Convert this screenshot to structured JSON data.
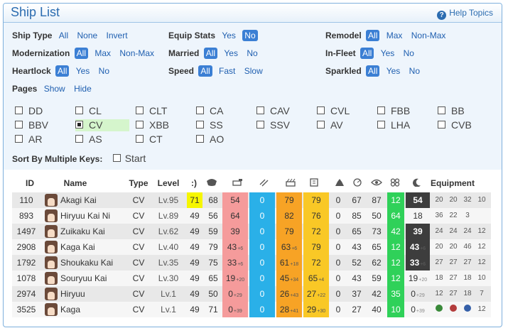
{
  "header": {
    "title": "Ship List",
    "help_label": "Help Topics",
    "help_icon": "question-circle-icon"
  },
  "filters": {
    "ship_type": {
      "label": "Ship Type",
      "options": [
        "All",
        "None",
        "Invert"
      ]
    },
    "equip_stats": {
      "label": "Equip Stats",
      "options": [
        "Yes",
        "No"
      ],
      "selected": "No"
    },
    "remodel": {
      "label": "Remodel",
      "options": [
        "All",
        "Max",
        "Non-Max"
      ],
      "selected": "All"
    },
    "modernization": {
      "label": "Modernization",
      "options": [
        "All",
        "Max",
        "Non-Max"
      ],
      "selected": "All"
    },
    "married": {
      "label": "Married",
      "options": [
        "All",
        "Yes",
        "No"
      ],
      "selected": "All"
    },
    "in_fleet": {
      "label": "In-Fleet",
      "options": [
        "All",
        "Yes",
        "No"
      ],
      "selected": "All"
    },
    "heartlock": {
      "label": "Heartlock",
      "options": [
        "All",
        "Yes",
        "No"
      ],
      "selected": "All"
    },
    "speed": {
      "label": "Speed",
      "options": [
        "All",
        "Fast",
        "Slow"
      ],
      "selected": "All"
    },
    "sparkled": {
      "label": "Sparkled",
      "options": [
        "All",
        "Yes",
        "No"
      ],
      "selected": "All"
    },
    "pages": {
      "label": "Pages",
      "options": [
        "Show",
        "Hide"
      ]
    }
  },
  "ship_types": [
    "DD",
    "CL",
    "CLT",
    "CA",
    "CAV",
    "CVL",
    "FBB",
    "BB",
    "BBV",
    "CV",
    "XBB",
    "SS",
    "SSV",
    "AV",
    "LHA",
    "CVB",
    "AR",
    "AS",
    "CT",
    "AO"
  ],
  "ship_types_checked": [
    "CV"
  ],
  "sort": {
    "label": "Sort By Multiple Keys:",
    "start_label": "Start"
  },
  "columns": {
    "id": "ID",
    "name": "Name",
    "type": "Type",
    "level": "Level",
    "morale": ":)",
    "equipment": "Equipment",
    "stat_icons": [
      "hp-icon",
      "firepower-icon",
      "torpedo-icon",
      "anti-air-icon",
      "armor-icon",
      "evasion-icon",
      "anti-sub-icon",
      "line-of-sight-icon",
      "luck-icon",
      "range-icon"
    ]
  },
  "rows": [
    {
      "id": "110",
      "name": "Akagi Kai",
      "type": "CV",
      "level": "Lv.95",
      "morale": "71",
      "hp": "68",
      "fp": "54",
      "fp_sub": "",
      "tp": "0",
      "aa": "79",
      "aa_sub": "",
      "ar": "79",
      "ar_sub": "",
      "asw": "0",
      "ev": "67",
      "los": "87",
      "luck": "12",
      "luck_sub": "",
      "range": "54",
      "range_sub": "",
      "eq": [
        "20",
        "20",
        "32",
        "10"
      ]
    },
    {
      "id": "893",
      "name": "Hiryuu Kai Ni",
      "type": "CV",
      "level": "Lv.89",
      "morale": "49",
      "hp": "56",
      "fp": "64",
      "fp_sub": "",
      "tp": "0",
      "aa": "82",
      "aa_sub": "",
      "ar": "76",
      "ar_sub": "",
      "asw": "0",
      "ev": "85",
      "los": "50",
      "luck": "64",
      "luck_sub": "",
      "range": "18",
      "range_sub": "",
      "eq": [
        "36",
        "22",
        "3",
        ""
      ]
    },
    {
      "id": "1497",
      "name": "Zuikaku Kai",
      "type": "CV",
      "level": "Lv.62",
      "morale": "49",
      "hp": "59",
      "fp": "39",
      "fp_sub": "",
      "tp": "0",
      "aa": "79",
      "aa_sub": "",
      "ar": "72",
      "ar_sub": "",
      "asw": "0",
      "ev": "65",
      "los": "73",
      "luck": "42",
      "luck_sub": "",
      "range": "39",
      "range_sub": "",
      "eq": [
        "24",
        "24",
        "24",
        "12"
      ]
    },
    {
      "id": "2908",
      "name": "Kaga Kai",
      "type": "CV",
      "level": "Lv.40",
      "morale": "49",
      "hp": "79",
      "fp": "43",
      "fp_sub": "+6",
      "tp": "0",
      "aa": "63",
      "aa_sub": "+6",
      "ar": "79",
      "ar_sub": "",
      "asw": "0",
      "ev": "43",
      "los": "65",
      "luck": "12",
      "luck_sub": "",
      "range": "43",
      "range_sub": "+6",
      "eq": [
        "20",
        "20",
        "46",
        "12"
      ]
    },
    {
      "id": "1792",
      "name": "Shoukaku Kai",
      "type": "CV",
      "level": "Lv.35",
      "morale": "49",
      "hp": "75",
      "fp": "33",
      "fp_sub": "+6",
      "tp": "0",
      "aa": "61",
      "aa_sub": "+18",
      "ar": "72",
      "ar_sub": "",
      "asw": "0",
      "ev": "52",
      "los": "62",
      "luck": "12",
      "luck_sub": "",
      "range": "33",
      "range_sub": "+6",
      "eq": [
        "27",
        "27",
        "27",
        "12"
      ]
    },
    {
      "id": "1078",
      "name": "Souryuu Kai",
      "type": "CV",
      "level": "Lv.30",
      "morale": "49",
      "hp": "65",
      "fp": "19",
      "fp_sub": "+20",
      "tp": "0",
      "aa": "45",
      "aa_sub": "+34",
      "ar": "65",
      "ar_sub": "+4",
      "asw": "0",
      "ev": "43",
      "los": "59",
      "luck": "12",
      "luck_sub": "",
      "range": "19",
      "range_sub": "+20",
      "eq": [
        "18",
        "27",
        "18",
        "10"
      ]
    },
    {
      "id": "2974",
      "name": "Hiryuu",
      "type": "CV",
      "level": "Lv.1",
      "morale": "49",
      "hp": "50",
      "fp": "0",
      "fp_sub": "+29",
      "tp": "0",
      "aa": "26",
      "aa_sub": "+43",
      "ar": "27",
      "ar_sub": "+22",
      "asw": "0",
      "ev": "37",
      "los": "42",
      "luck": "35",
      "luck_sub": "",
      "range": "0",
      "range_sub": "+29",
      "eq": [
        "12",
        "27",
        "18",
        "7"
      ]
    },
    {
      "id": "3525",
      "name": "Kaga",
      "type": "CV",
      "level": "Lv.1",
      "morale": "49",
      "hp": "71",
      "fp": "0",
      "fp_sub": "+39",
      "tp": "0",
      "aa": "28",
      "aa_sub": "+41",
      "ar": "29",
      "ar_sub": "+30",
      "asw": "0",
      "ev": "27",
      "los": "40",
      "luck": "10",
      "luck_sub": "",
      "range": "0",
      "range_sub": "+39",
      "eq": [
        "",
        "",
        "",
        "12"
      ],
      "eq_icons": [
        "green",
        "red",
        "blue"
      ]
    }
  ]
}
